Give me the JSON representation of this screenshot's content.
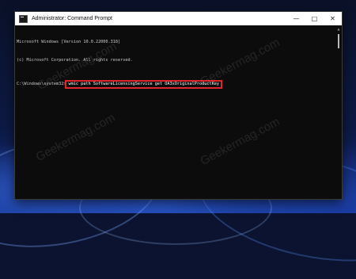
{
  "window": {
    "title": "Administrator: Command Prompt",
    "app_icon": "cmd-icon",
    "controls": {
      "minimize": "minimize-icon",
      "maximize": "maximize-icon",
      "close": "close-icon"
    }
  },
  "console": {
    "lines": [
      "Microsoft Windows [Version 10.0.22000.318]",
      "(c) Microsoft Corporation. All rights reserved."
    ],
    "prompt": "C:\\Windows\\system32>",
    "command": "wmic path SoftwareLicensingService get OA3xOriginalProductKey"
  },
  "watermark": "Geekermag.com",
  "colors": {
    "highlight_border": "#e0262b",
    "console_bg": "#0c0c0c",
    "console_text": "#cccccc"
  }
}
